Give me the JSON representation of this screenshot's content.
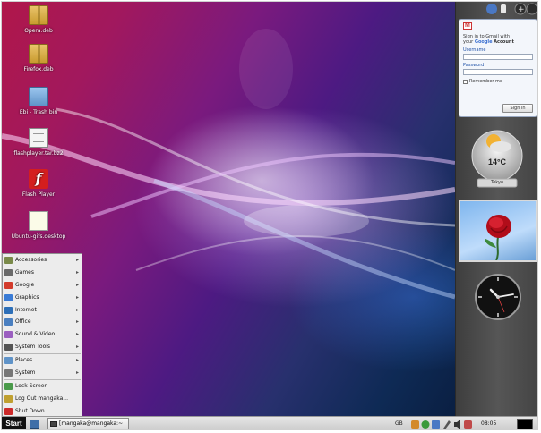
{
  "desktop": {
    "icons": [
      {
        "label": "Opera.deb",
        "icon": "package-icon"
      },
      {
        "label": "Firefox.deb",
        "icon": "package-icon"
      },
      {
        "label": "Ebi - Trash bin",
        "icon": "folder-icon"
      },
      {
        "label": "flashplayer.tar.bz2",
        "icon": "archive-icon"
      },
      {
        "label": "Flash Player",
        "icon": "flash-icon"
      },
      {
        "label": "Ubuntu-gifs.desktop",
        "icon": "launcher-icon"
      }
    ]
  },
  "start_menu": {
    "items": [
      {
        "label": "Accessories",
        "icon": "accessories-icon",
        "color": "#7a8a4a",
        "submenu": true
      },
      {
        "label": "Games",
        "icon": "games-icon",
        "color": "#6a6a6a",
        "submenu": true
      },
      {
        "label": "Google",
        "icon": "google-icon",
        "color": "#d33b2c",
        "submenu": true
      },
      {
        "label": "Graphics",
        "icon": "graphics-icon",
        "color": "#3a7bd5",
        "submenu": true
      },
      {
        "label": "Internet",
        "icon": "globe-icon",
        "color": "#2d6fb8",
        "submenu": true
      },
      {
        "label": "Office",
        "icon": "office-icon",
        "color": "#4a7fc0",
        "submenu": true
      },
      {
        "label": "Sound & Video",
        "icon": "sound-video-icon",
        "color": "#9b5fc0",
        "submenu": true
      },
      {
        "label": "System Tools",
        "icon": "system-tools-icon",
        "color": "#555555",
        "submenu": true
      }
    ],
    "items2": [
      {
        "label": "Places",
        "icon": "places-icon",
        "color": "#5f93c8",
        "submenu": true
      },
      {
        "label": "System",
        "icon": "system-icon",
        "color": "#777777",
        "submenu": true
      }
    ],
    "items3": [
      {
        "label": "Lock Screen",
        "icon": "lock-icon",
        "color": "#4a9a4a",
        "submenu": false
      },
      {
        "label": "Log Out mangaka...",
        "icon": "logout-icon",
        "color": "#c0a030",
        "submenu": false
      },
      {
        "label": "Shut Down...",
        "icon": "shutdown-icon",
        "color": "#cc2a2a",
        "submenu": false
      }
    ],
    "arrow_glyph": "▸"
  },
  "taskbar": {
    "start_label": "Start",
    "window_title": "[mangaka@mangaka:~",
    "language": "GB",
    "clock": "08:05"
  },
  "sidebar": {
    "gmail": {
      "line1": "Sign in to Gmail with",
      "line2_pre": "your",
      "google": "Google",
      "line2_post": "Account",
      "username_label": "Username",
      "password_label": "Password",
      "remember_label": "Remember me",
      "signin_label": "Sign in"
    },
    "weather": {
      "temperature": "14°C",
      "city": "Tokyo"
    }
  },
  "colors": {
    "accent": "#1c4fa6",
    "menu_bg": "#ececec",
    "sidebar_bg": "#4a4a4a"
  }
}
